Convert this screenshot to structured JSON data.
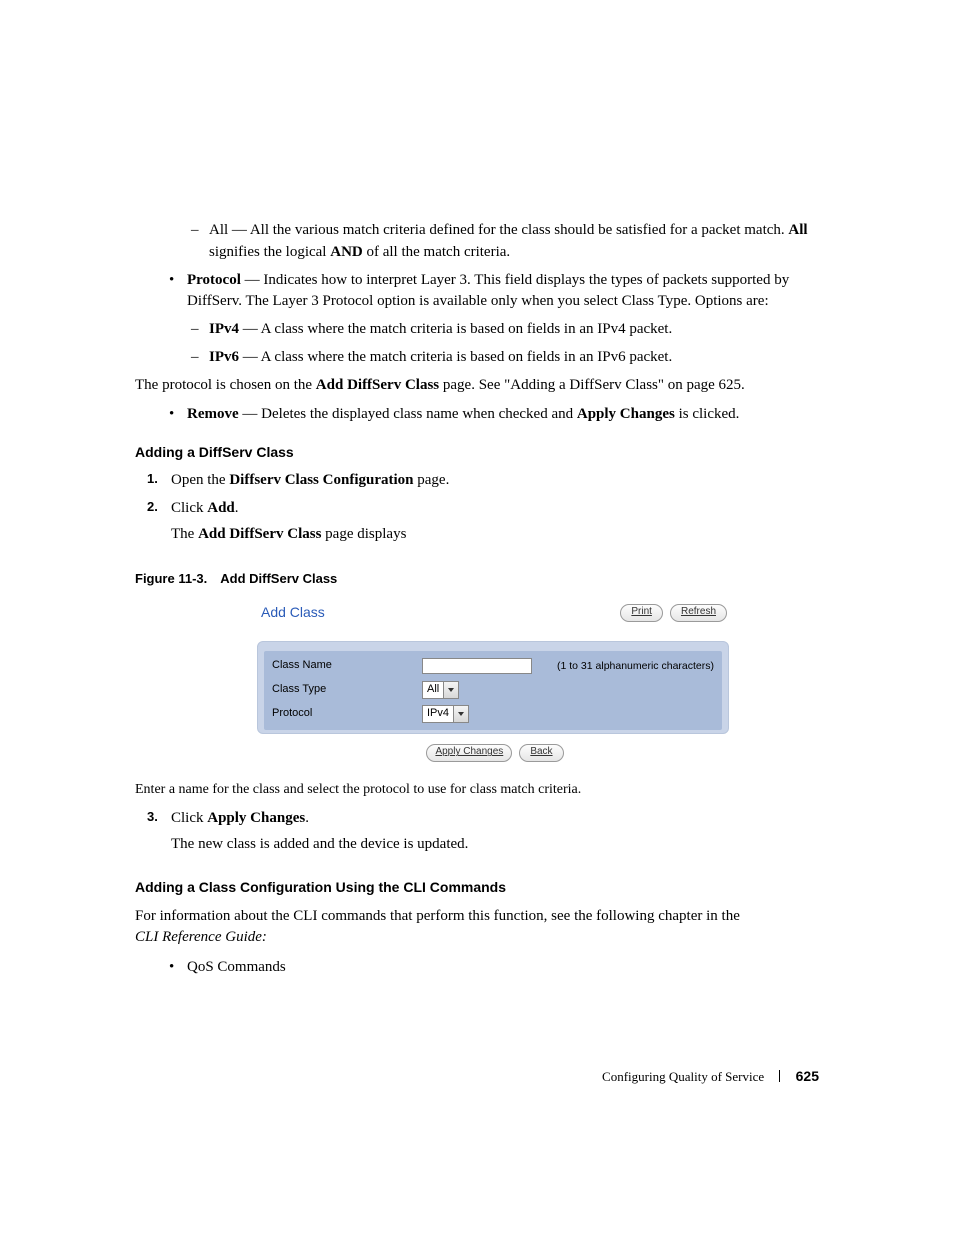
{
  "body": {
    "dash_all_pre": "All — All the various match criteria defined for the class should be satisfied for a packet match. ",
    "dash_all_bold1": "All",
    "dash_all_mid": " signifies the logical ",
    "dash_all_bold2": "AND",
    "dash_all_post": " of all the match criteria.",
    "bullet_protocol_bold": "Protocol",
    "bullet_protocol_text": " — Indicates how to interpret Layer 3. This field displays the types of packets supported by DiffServ. The Layer 3 Protocol option is available only when you select Class Type. Options are:",
    "dash_ipv4_bold": "IPv4",
    "dash_ipv4_text": " — A class where the match criteria is based on fields in an IPv4 packet.",
    "dash_ipv6_bold": "IPv6",
    "dash_ipv6_text": " — A class where the match criteria is based on fields in an IPv6 packet.",
    "proto_chosen_pre": "The protocol is chosen on the ",
    "proto_chosen_bold": "Add DiffServ Class",
    "proto_chosen_post": " page. See \"Adding a DiffServ Class\" on page 625.",
    "bullet_remove_bold": "Remove",
    "bullet_remove_mid": " — Deletes the displayed class name when checked and ",
    "bullet_remove_bold2": "Apply Changes",
    "bullet_remove_post": " is clicked.",
    "h_adding": "Adding a DiffServ Class",
    "step1_pre": "Open the ",
    "step1_bold": "Diffserv Class Configuration",
    "step1_post": " page.",
    "step2_pre": "Click ",
    "step2_bold": "Add",
    "step2_post": ".",
    "step2_follow_pre": "The ",
    "step2_follow_bold": "Add DiffServ Class",
    "step2_follow_post": " page displays",
    "figcap": "Figure 11-3. Add DiffServ Class",
    "caption_follow": "Enter a name for the class and select the protocol to use for class match criteria.",
    "step3_pre": "Click ",
    "step3_bold": "Apply Changes",
    "step3_post": ".",
    "step3_follow": "The new class is added and the device is updated.",
    "h_cli": "Adding a Class Configuration Using the CLI Commands",
    "cli_text": "For information about the CLI commands that perform this function, see the following chapter in the ",
    "cli_italic": "CLI Reference Guide:",
    "cli_bullet": "QoS Commands"
  },
  "ui": {
    "title": "Add Class",
    "print": "Print",
    "refresh": "Refresh",
    "rows": {
      "class_name_label": "Class Name",
      "class_name_value": "",
      "class_name_hint": "(1 to 31 alphanumeric characters)",
      "class_type_label": "Class Type",
      "class_type_value": "All",
      "protocol_label": "Protocol",
      "protocol_value": "IPv4"
    },
    "apply": "Apply Changes",
    "back": "Back"
  },
  "footer": {
    "section": "Configuring Quality of Service",
    "page": "625"
  }
}
